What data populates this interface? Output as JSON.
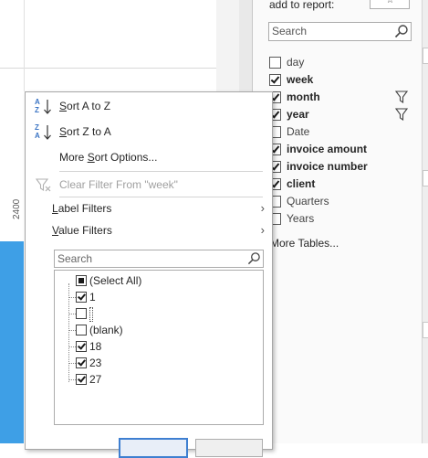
{
  "field_list": {
    "header": "add to report:",
    "search_placeholder": "Search",
    "fields": [
      {
        "label": "day",
        "checked": false,
        "bold": false,
        "filter": false
      },
      {
        "label": "week",
        "checked": true,
        "bold": true,
        "filter": false
      },
      {
        "label": "month",
        "checked": true,
        "bold": true,
        "filter": true
      },
      {
        "label": "year",
        "checked": true,
        "bold": true,
        "filter": true
      },
      {
        "label": "Date",
        "checked": false,
        "bold": false,
        "filter": false
      },
      {
        "label": "invoice amount",
        "checked": true,
        "bold": true,
        "filter": false
      },
      {
        "label": "invoice number",
        "checked": true,
        "bold": true,
        "filter": false
      },
      {
        "label": "client",
        "checked": true,
        "bold": true,
        "filter": false
      },
      {
        "label": "Quarters",
        "checked": false,
        "bold": false,
        "filter": false
      },
      {
        "label": "Years",
        "checked": false,
        "bold": false,
        "filter": false
      }
    ],
    "more_tables": "More Tables..."
  },
  "chart": {
    "axis_label": "2400",
    "bar_color": "#3e9fe6"
  },
  "filter_menu": {
    "sort_a_z": {
      "label": "Sort A to Z",
      "icon_top": "A",
      "icon_bottom": "Z"
    },
    "sort_z_a": {
      "label": "Sort Z to A",
      "icon_top": "Z",
      "icon_bottom": "A"
    },
    "more_sort": "More Sort Options...",
    "clear_filter": "Clear Filter From \"week\"",
    "label_filters": "Label Filters",
    "value_filters": "Value Filters",
    "search_placeholder": "Search",
    "values": [
      {
        "label": "(Select All)",
        "state": "partial"
      },
      {
        "label": "1",
        "state": "checked"
      },
      {
        "label": "",
        "state": "unchecked"
      },
      {
        "label": "(blank)",
        "state": "unchecked"
      },
      {
        "label": "18",
        "state": "checked"
      },
      {
        "label": "23",
        "state": "checked"
      },
      {
        "label": "27",
        "state": "checked"
      }
    ]
  },
  "colors": {
    "accent": "#3e7fd1",
    "sort_icon": "#3b74c4"
  }
}
